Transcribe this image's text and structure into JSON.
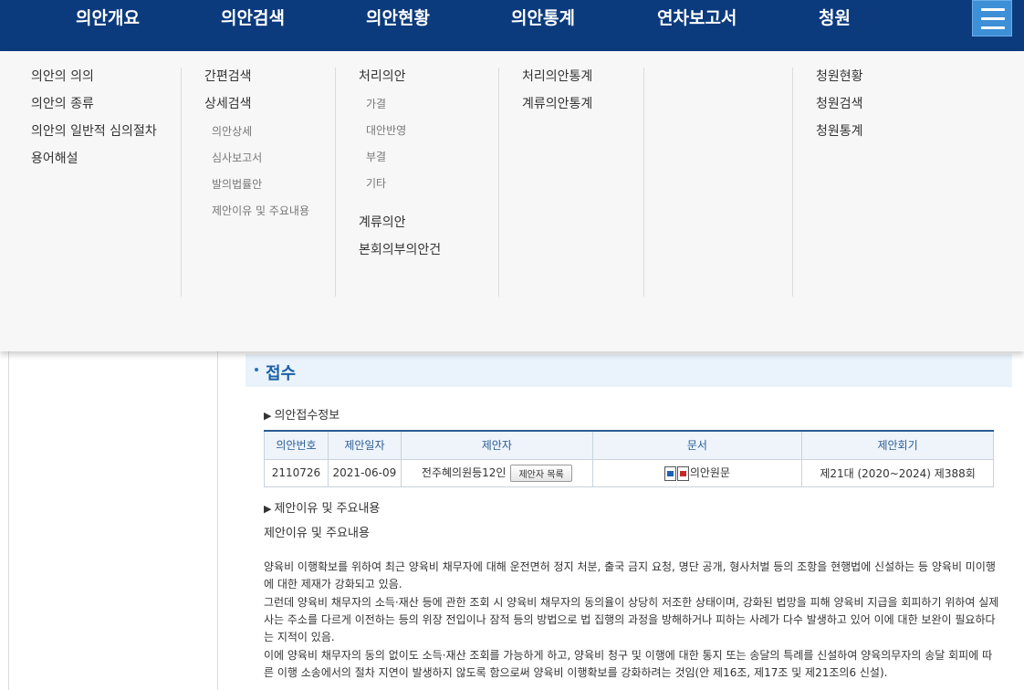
{
  "topnav": {
    "items": [
      "의안개요",
      "의안검색",
      "의안현황",
      "의안통계",
      "연차보고서",
      "청원"
    ]
  },
  "mega": {
    "col1": [
      "의안의 의의",
      "의안의 종류",
      "의안의 일반적 심의절차",
      "용어해설"
    ],
    "col2": {
      "main": [
        "간편검색",
        "상세검색"
      ],
      "sub": [
        "의안상세",
        "심사보고서",
        "발의법률안",
        "제안이유 및 주요내용"
      ]
    },
    "col3": {
      "main": "처리의안",
      "sub": [
        "가결",
        "대안반영",
        "부결",
        "기타"
      ],
      "extra": [
        "계류의안",
        "본회의부의안건"
      ]
    },
    "col4": [
      "처리의안통계",
      "계류의안통계"
    ],
    "col6": [
      "청원현황",
      "청원검색",
      "청원통계"
    ]
  },
  "section": {
    "title": "접수"
  },
  "reception": {
    "heading": "의안접수정보",
    "headers": [
      "의안번호",
      "제안일자",
      "제안자",
      "문서",
      "제안회기"
    ],
    "row": {
      "bill_no": "2110726",
      "date": "2021-06-09",
      "proposer": "전주혜의원등12인",
      "proposer_button": "제안자 목록",
      "doc": "의안원문",
      "session": "제21대 (2020~2024) 제388회"
    }
  },
  "reason": {
    "heading": "제안이유 및 주요내용",
    "label": "제안이유 및 주요내용",
    "paragraphs": [
      "양육비 이행확보를 위하여 최근 양육비 채무자에 대해 운전면허 정지 처분, 출국 금지 요청, 명단 공개, 형사처벌 등의 조항을 현행법에 신설하는 등 양육비 미이행에 대한 제재가 강화되고 있음.",
      "그런데 양육비 채무자의 소득·재산 등에 관한 조회 시 양육비 채무자의 동의율이 상당히 저조한 상태이며, 강화된 법망을 피해 양육비 지급을 회피하기 위하여 실제 사는 주소를 다르게 이전하는 등의 위장 전입이나 잠적 등의 방법으로 법 집행의 과정을 방해하거나 피하는 사례가 다수 발생하고 있어 이에 대한 보완이 필요하다는 지적이 있음.",
      "이에 양육비 채무자의 동의 없이도 소득·재산 조회를 가능하게 하고, 양육비 청구 및 이행에 대한 통지 또는 송달의 특례를 신설하여 양육의무자의 송달 회피에 따른 이행 소송에서의 절차 지연이 발생하지 않도록 함으로써 양육비 이행확보를 강화하려는 것임(안 제16조, 제17조 및 제21조의6 신설)."
    ]
  }
}
